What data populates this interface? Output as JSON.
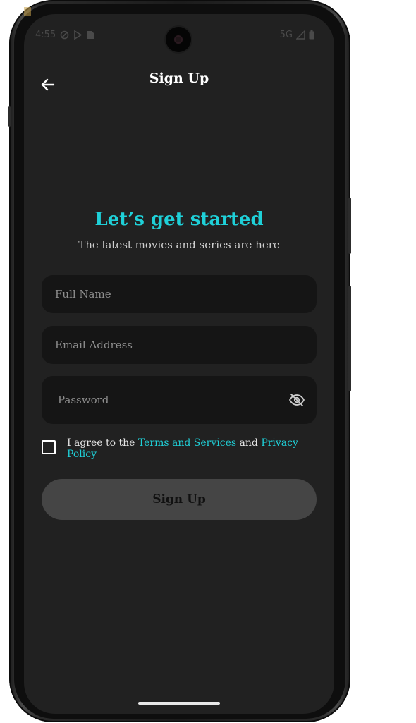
{
  "status_bar": {
    "time": "4:55",
    "network": "5G"
  },
  "app_bar": {
    "title": "Sign Up",
    "back_icon": "arrow-left-icon"
  },
  "hero": {
    "headline": "Let’s get started",
    "subheadline": "The latest movies and series are here"
  },
  "form": {
    "full_name_placeholder": "Full Name",
    "email_placeholder": "Email Address",
    "password_placeholder": "Password",
    "password_toggle_icon": "eye-off-icon",
    "agree_prefix": "I agree to the ",
    "terms_link": "Terms and Services",
    "agree_middle": " and ",
    "privacy_link": "Privacy Policy",
    "submit_label": "Sign Up"
  },
  "colors": {
    "accent": "#1fd0d8",
    "screen_bg": "#212121",
    "field_bg": "#151515",
    "button_bg": "#454545"
  }
}
